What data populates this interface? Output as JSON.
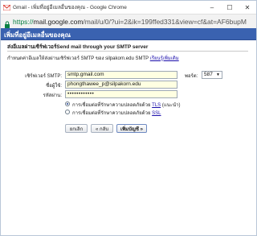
{
  "window": {
    "title": "Gmail - เพิ่มที่อยู่อีเมลอื่นของคุณ - Google Chrome",
    "controls": {
      "minimize": "–",
      "maximize": "☐",
      "close": "✕"
    }
  },
  "address_bar": {
    "secure_label": "ปลอดภัย",
    "url_scheme": "https://",
    "url_host": "mail.google.com",
    "url_rest": "/mail/u/0/?ui=2&ik=199ffed331&view=cf&at=AF6bupM"
  },
  "dialog": {
    "title": "เพิ่มที่อยู่อีเมลอื่นของคุณ",
    "section_heading": "ส่งอีเมลผ่านเซิร์ฟเวอร์Send mail through your SMTP server",
    "instructions": "กำหนดค่าอีเมลให้ส่งผ่านเซิร์ฟเวอร์ SMTP ของ silpakorn.edu SMTP",
    "learn_more_link": "เรียนรู้เพิ่มเติม"
  },
  "form": {
    "smtp_server": {
      "label": "เซิร์ฟเวอร์ SMTP:",
      "value": "smtp.gmail.com"
    },
    "port": {
      "label": "พอร์ต:",
      "value": "587"
    },
    "username": {
      "label": "ชื่อผู้ใช้:",
      "value": "phongthawee_p@silpakorn.edu"
    },
    "password": {
      "label": "รหัสผ่าน:",
      "value": "••••••••••••"
    },
    "security_options": [
      {
        "label_prefix": "การเชื่อมต่อที่รักษาความปลอดภัยด้วย ",
        "protocol": "TLS",
        "suffix": " (แนะนำ)",
        "checked": true
      },
      {
        "label_prefix": "การเชื่อมต่อที่รักษาความปลอดภัยด้วย ",
        "protocol": "SSL",
        "suffix": "",
        "checked": false
      }
    ]
  },
  "buttons": {
    "cancel": "ยกเลิก",
    "back": "« กลับ",
    "add_account": "เพิ่มบัญชี »"
  },
  "colors": {
    "header_blue": "#3a62b0",
    "input_background": "#ffffe2",
    "secure_green": "#0b8043",
    "link_blue": "#1a0dab"
  }
}
